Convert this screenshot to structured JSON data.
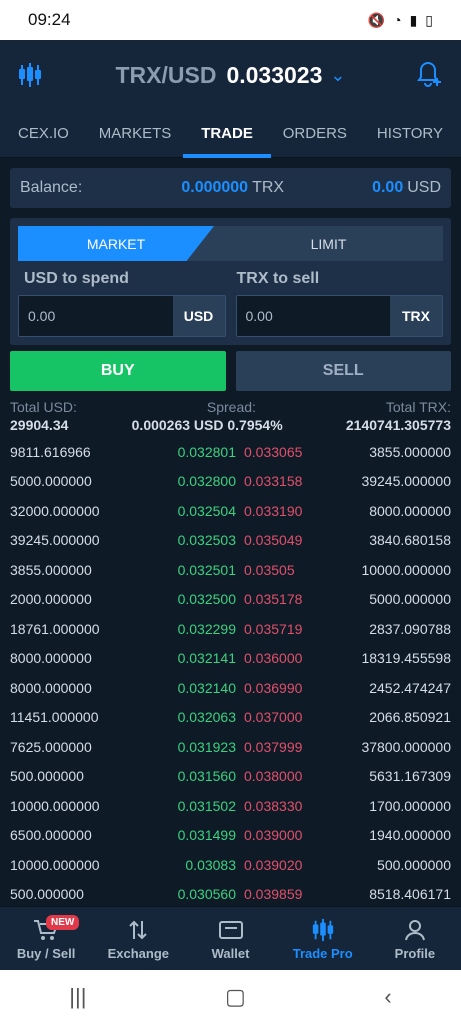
{
  "status": {
    "time": "09:24"
  },
  "header": {
    "pair": "TRX/USD",
    "price": "0.033023"
  },
  "tabs": [
    "CEX.IO",
    "MARKETS",
    "TRADE",
    "ORDERS",
    "HISTORY"
  ],
  "balance": {
    "label": "Balance:",
    "trx_amount": "0.000000",
    "trx_cur": "TRX",
    "usd_amount": "0.00",
    "usd_cur": "USD"
  },
  "order_form": {
    "market_label": "MARKET",
    "limit_label": "LIMIT",
    "spend_label": "USD to spend",
    "sell_label": "TRX to sell",
    "spend_value": "0.00",
    "spend_unit": "USD",
    "sell_value": "0.00",
    "sell_unit": "TRX",
    "buy_button": "BUY",
    "sell_button": "SELL"
  },
  "orderbook": {
    "total_usd_label": "Total USD:",
    "spread_label": "Spread:",
    "total_trx_label": "Total TRX:",
    "total_usd": "29904.34",
    "spread": "0.000263 USD 0.7954%",
    "total_trx": "2140741.305773",
    "rows": [
      [
        "9811.616966",
        "0.032801",
        "0.033065",
        "3855.000000"
      ],
      [
        "5000.000000",
        "0.032800",
        "0.033158",
        "39245.000000"
      ],
      [
        "32000.000000",
        "0.032504",
        "0.033190",
        "8000.000000"
      ],
      [
        "39245.000000",
        "0.032503",
        "0.035049",
        "3840.680158"
      ],
      [
        "3855.000000",
        "0.032501",
        "0.03505",
        "10000.000000"
      ],
      [
        "2000.000000",
        "0.032500",
        "0.035178",
        "5000.000000"
      ],
      [
        "18761.000000",
        "0.032299",
        "0.035719",
        "2837.090788"
      ],
      [
        "8000.000000",
        "0.032141",
        "0.036000",
        "18319.455598"
      ],
      [
        "8000.000000",
        "0.032140",
        "0.036990",
        "2452.474247"
      ],
      [
        "11451.000000",
        "0.032063",
        "0.037000",
        "2066.850921"
      ],
      [
        "7625.000000",
        "0.031923",
        "0.037999",
        "37800.000000"
      ],
      [
        "500.000000",
        "0.031560",
        "0.038000",
        "5631.167309"
      ],
      [
        "10000.000000",
        "0.031502",
        "0.038330",
        "1700.000000"
      ],
      [
        "6500.000000",
        "0.031499",
        "0.039000",
        "1940.000000"
      ],
      [
        "10000.000000",
        "0.03083",
        "0.039020",
        "500.000000"
      ],
      [
        "500.000000",
        "0.030560",
        "0.039859",
        "8518.406171"
      ]
    ]
  },
  "bottom_nav": {
    "badge": "NEW",
    "items": [
      "Buy / Sell",
      "Exchange",
      "Wallet",
      "Trade Pro",
      "Profile"
    ]
  },
  "colors": {
    "accent": "#1b8fff",
    "buy": "#16c466",
    "bid": "#3bd17f",
    "ask": "#e0506a"
  }
}
